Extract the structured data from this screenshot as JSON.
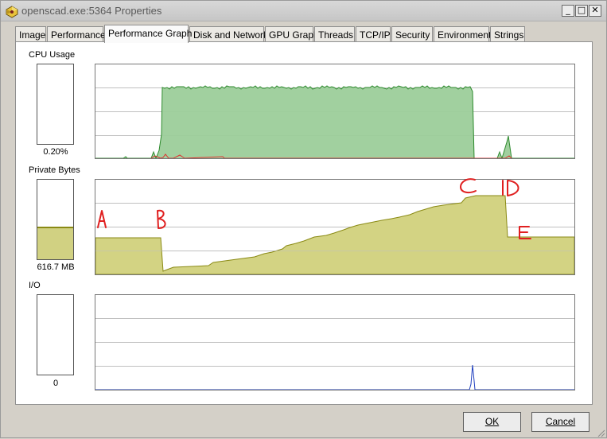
{
  "window": {
    "title": "openscad.exe:5364 Properties",
    "minimize_glyph": "_",
    "maximize_glyph": "□",
    "close_glyph": "✕"
  },
  "tabs": [
    {
      "label": "Image",
      "active": false
    },
    {
      "label": "Performance",
      "active": false
    },
    {
      "label": "Performance Graph",
      "active": true
    },
    {
      "label": "Disk and Network",
      "active": false
    },
    {
      "label": "GPU Graph",
      "active": false
    },
    {
      "label": "Threads",
      "active": false
    },
    {
      "label": "TCP/IP",
      "active": false
    },
    {
      "label": "Security",
      "active": false
    },
    {
      "label": "Environment",
      "active": false
    },
    {
      "label": "Strings",
      "active": false
    }
  ],
  "cpu": {
    "label": "CPU Usage",
    "value_text": "0.20%",
    "meter_fill_fraction": 0.002,
    "color_fill": "#9ccd9a",
    "color_line": "#2d8a2d",
    "color_kernel": "#e03030"
  },
  "private_bytes": {
    "label": "Private Bytes",
    "value_text": "616.7 MB",
    "meter_fill_fraction": 0.4,
    "color_fill": "#d3d383",
    "color_line": "#8a8a14"
  },
  "io": {
    "label": "I/O",
    "value_text": "0",
    "color_line": "#1f3fbf"
  },
  "annotations": {
    "color": "#e02020",
    "labels": [
      "A",
      "B",
      "C",
      "D",
      "E"
    ]
  },
  "buttons": {
    "ok": "OK",
    "cancel": "Cancel"
  }
}
